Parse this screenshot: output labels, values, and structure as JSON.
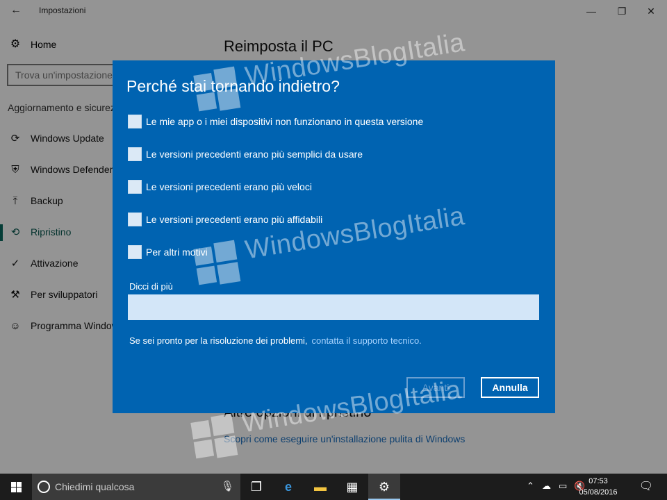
{
  "window": {
    "title": "Impostazioni",
    "back_icon": "←",
    "minimize_icon": "—",
    "restore_icon": "❐",
    "close_icon": "✕"
  },
  "sidebar": {
    "home_icon": "⚙",
    "home_label": "Home",
    "search_placeholder": "Trova un'impostazione",
    "section_heading": "Aggiornamento e sicurezza",
    "items": [
      {
        "label": "Windows Update",
        "icon": "⟳",
        "icon_name": "sync-icon"
      },
      {
        "label": "Windows Defender",
        "icon": "⛨",
        "icon_name": "shield-icon"
      },
      {
        "label": "Backup",
        "icon": "⤒",
        "icon_name": "backup-arrow-icon"
      },
      {
        "label": "Ripristino",
        "icon": "⟲",
        "icon_name": "history-icon"
      },
      {
        "label": "Attivazione",
        "icon": "✓",
        "icon_name": "check-circle-icon"
      },
      {
        "label": "Per sviluppatori",
        "icon": "⚒",
        "icon_name": "developer-tools-icon"
      },
      {
        "label": "Programma Windows Insider",
        "icon": "☺",
        "icon_name": "insider-person-icon"
      }
    ],
    "active_index": 3
  },
  "main": {
    "title": "Reimposta il PC",
    "other_options_heading": "Altre opzioni di ripristino",
    "clean_install_link": "Scopri come eseguire un'installazione pulita di Windows"
  },
  "dialog": {
    "title": "Perché stai tornando indietro?",
    "options": [
      "Le mie app o i miei dispositivi non funzionano in questa versione",
      "Le versioni precedenti erano più semplici da usare",
      "Le versioni precedenti erano più veloci",
      "Le versioni precedenti erano più affidabili",
      "Per altri motivi"
    ],
    "tell_more_label": "Dicci di più",
    "tell_more_value": "",
    "help_text": "Se sei pronto per la risoluzione dei problemi,",
    "help_link": "contatta il supporto tecnico.",
    "next_button": "Avanti",
    "cancel_button": "Annulla"
  },
  "watermark": "WindowsBlogItalia",
  "taskbar": {
    "search_placeholder": "Chiedimi qualcosa",
    "time": "07:53",
    "date": "05/08/2016",
    "colors": {
      "background": "#1c1c1c",
      "search": "#3b3b3b",
      "accent": "#0063b1"
    }
  }
}
